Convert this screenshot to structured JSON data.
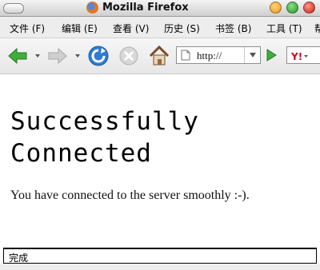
{
  "window": {
    "title": "Mozilla Firefox"
  },
  "menubar": {
    "items": [
      {
        "label": "文件 (F)"
      },
      {
        "label": "编辑 (E)"
      },
      {
        "label": "查看 (V)"
      },
      {
        "label": "历史 (S)"
      },
      {
        "label": "书签 (B)"
      },
      {
        "label": "工具 (T)"
      },
      {
        "label": "帮"
      }
    ]
  },
  "toolbar": {
    "back_icon": "back-arrow-icon",
    "forward_icon": "forward-arrow-icon",
    "reload_icon": "reload-icon",
    "stop_icon": "stop-icon",
    "home_icon": "home-icon"
  },
  "urlbar": {
    "value": "http://"
  },
  "search": {
    "engine_icon": "yahoo-icon"
  },
  "page": {
    "heading_line1": "Successfully",
    "heading_line2": "Connected",
    "message": "You have connected to the server smoothly :-)."
  },
  "status": {
    "text": "完成"
  },
  "colors": {
    "close": "#e14b3f",
    "minimize": "#f2b13a",
    "zoom": "#4bb34a",
    "accent": "#2f7dd1"
  }
}
